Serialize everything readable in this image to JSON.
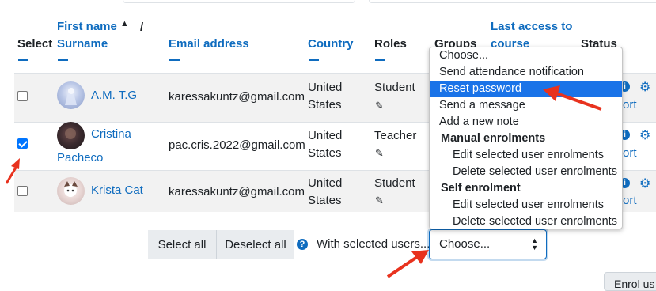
{
  "header": {
    "select": "Select",
    "first_name": "First name",
    "sort_asc": "▲",
    "slash": "/",
    "surname": "Surname",
    "email": "Email address",
    "country": "Country",
    "roles": "Roles",
    "groups": "Groups",
    "last_access_line1": "Last access to",
    "last_access_line2": "course",
    "status": "Status"
  },
  "rows": [
    {
      "name": "A.M. T.G",
      "name_line2": "",
      "email": "karessakuntz@gmail.com",
      "country_line1": "United",
      "country_line2": "States",
      "role": "Student",
      "checked": false,
      "status_partial": "ort"
    },
    {
      "name": "Cristina",
      "name_line2": "Pacheco",
      "email": "pac.cris.2022@gmail.com",
      "country_line1": "United",
      "country_line2": "States",
      "role": "Teacher",
      "checked": true,
      "status_partial": "ort"
    },
    {
      "name": "Krista Cat",
      "name_line2": "",
      "email": "karessakuntz@gmail.com",
      "country_line1": "United",
      "country_line2": "States",
      "role": "Student",
      "checked": false,
      "status_partial": "ort"
    }
  ],
  "controls": {
    "select_all": "Select all",
    "deselect_all": "Deselect all",
    "with_selected": "With selected users...",
    "select_value": "Choose...",
    "enrol_button": "Enrol us"
  },
  "dropdown": {
    "options": [
      {
        "label": "Choose...",
        "kind": "option",
        "selected": false
      },
      {
        "label": "Send attendance notification",
        "kind": "option",
        "selected": false
      },
      {
        "label": "Reset password",
        "kind": "option",
        "selected": true
      },
      {
        "label": "Send a message",
        "kind": "option",
        "selected": false
      },
      {
        "label": "Add a new note",
        "kind": "option",
        "selected": false
      },
      {
        "label": "Manual enrolments",
        "kind": "group",
        "selected": false
      },
      {
        "label": "Edit selected user enrolments",
        "kind": "sub",
        "selected": false
      },
      {
        "label": "Delete selected user enrolments",
        "kind": "sub",
        "selected": false
      },
      {
        "label": "Self enrolment",
        "kind": "group",
        "selected": false
      },
      {
        "label": "Edit selected user enrolments",
        "kind": "sub",
        "selected": false
      },
      {
        "label": "Delete selected user enrolments",
        "kind": "sub",
        "selected": false
      }
    ]
  },
  "icons": {
    "pencil": "pencil-icon",
    "cog": "gear-icon",
    "info": "info-icon",
    "help": "help-icon",
    "sort": "sort-ascending-icon"
  },
  "colors": {
    "link": "#0f6cbf",
    "highlight": "#1a73e8",
    "annotation": "#e8321e",
    "row_shade": "#f2f2f2"
  }
}
